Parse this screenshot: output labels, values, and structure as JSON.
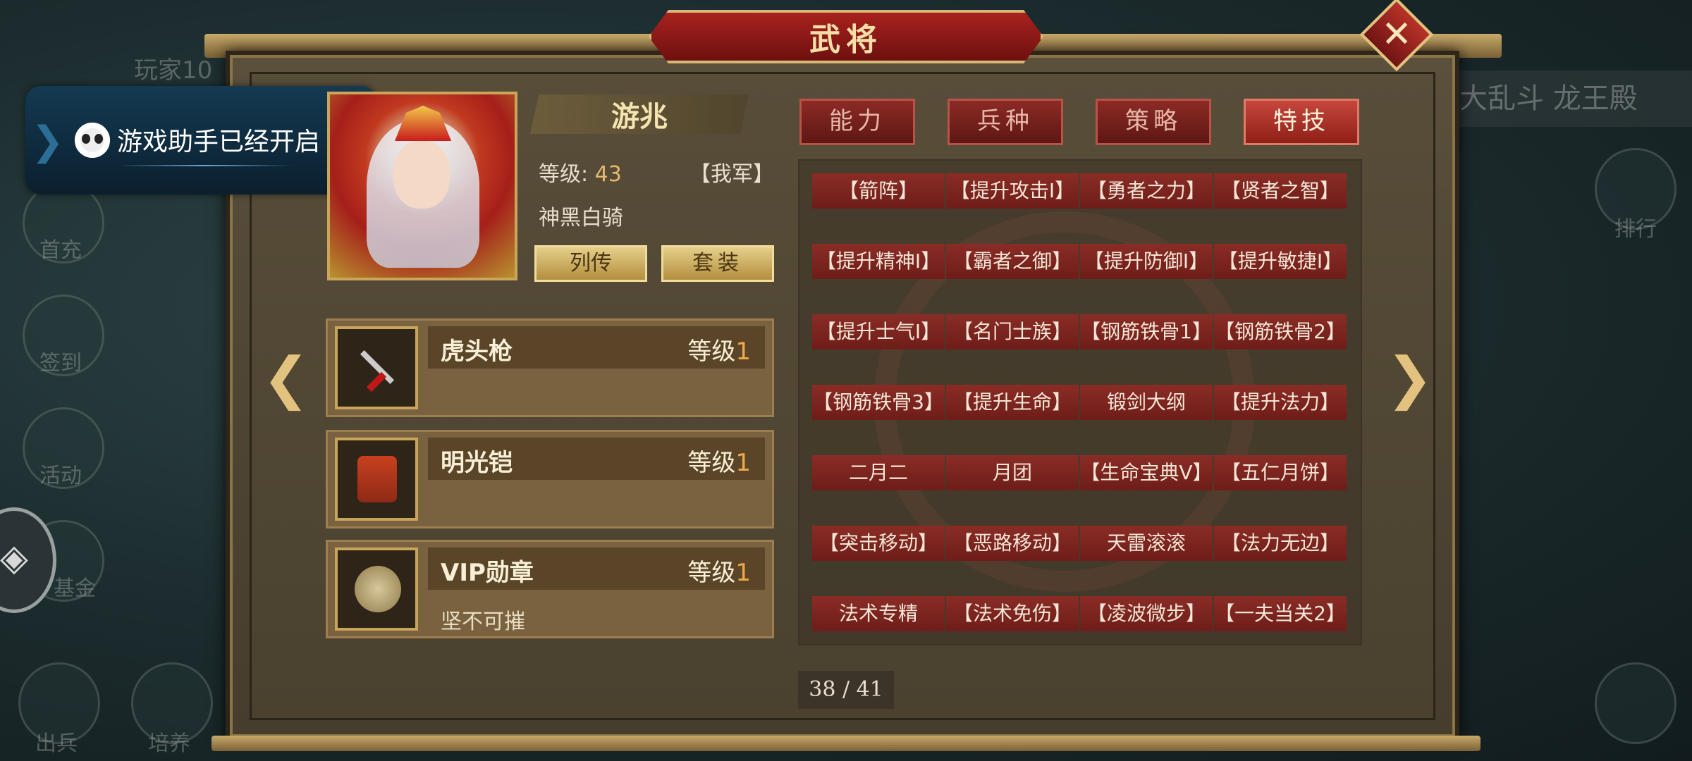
{
  "background": {
    "player_label": "玩家10",
    "side_buttons": [
      "首充",
      "签到",
      "活动",
      "基金"
    ],
    "bottom_buttons": [
      "出兵",
      "培养"
    ],
    "ranking": "排行",
    "banner": "大乱斗 龙王殿"
  },
  "toast": {
    "text": "游戏助手已经开启"
  },
  "panel": {
    "title": "武将",
    "close_icon": "close-icon"
  },
  "general": {
    "name": "游兆",
    "level_label": "等级:",
    "level_value": "43",
    "faction": "【我军】",
    "unit_type": "神黑白骑",
    "buttons": {
      "biography": "列传",
      "set": "套装"
    }
  },
  "equipment": [
    {
      "name": "虎头枪",
      "level_label": "等级",
      "level": "1",
      "sub": ""
    },
    {
      "name": "明光铠",
      "level_label": "等级",
      "level": "1",
      "sub": ""
    },
    {
      "name": "VIP勋章",
      "level_label": "等级",
      "level": "1",
      "sub": "坚不可摧"
    }
  ],
  "tabs": [
    {
      "label": "能力",
      "active": false
    },
    {
      "label": "兵种",
      "active": false
    },
    {
      "label": "策略",
      "active": false
    },
    {
      "label": "特技",
      "active": true
    }
  ],
  "skills": [
    [
      "【箭阵】",
      "【提升攻击Ⅰ】",
      "【勇者之力】",
      "【贤者之智】"
    ],
    [
      "【提升精神Ⅰ】",
      "【霸者之御】",
      "【提升防御Ⅰ】",
      "【提升敏捷Ⅰ】"
    ],
    [
      "【提升士气Ⅰ】",
      "【名门士族】",
      "【钢筋铁骨1】",
      "【钢筋铁骨2】"
    ],
    [
      "【钢筋铁骨3】",
      "【提升生命】",
      "锻剑大纲",
      "【提升法力】"
    ],
    [
      "二月二",
      "月团",
      "【生命宝典Ⅴ】",
      "【五仁月饼】"
    ],
    [
      "【突击移动】",
      "【恶路移动】",
      "天雷滚滚",
      "【法力无边】"
    ],
    [
      "法术专精",
      "【法术免伤】",
      "【凌波微步】",
      "【一夫当关2】"
    ]
  ],
  "pager": {
    "text": "38 / 41"
  },
  "colors": {
    "accent_gold": "#e2c27e",
    "tab_red": "#8c2a24",
    "level_orange": "#f0a84a"
  }
}
